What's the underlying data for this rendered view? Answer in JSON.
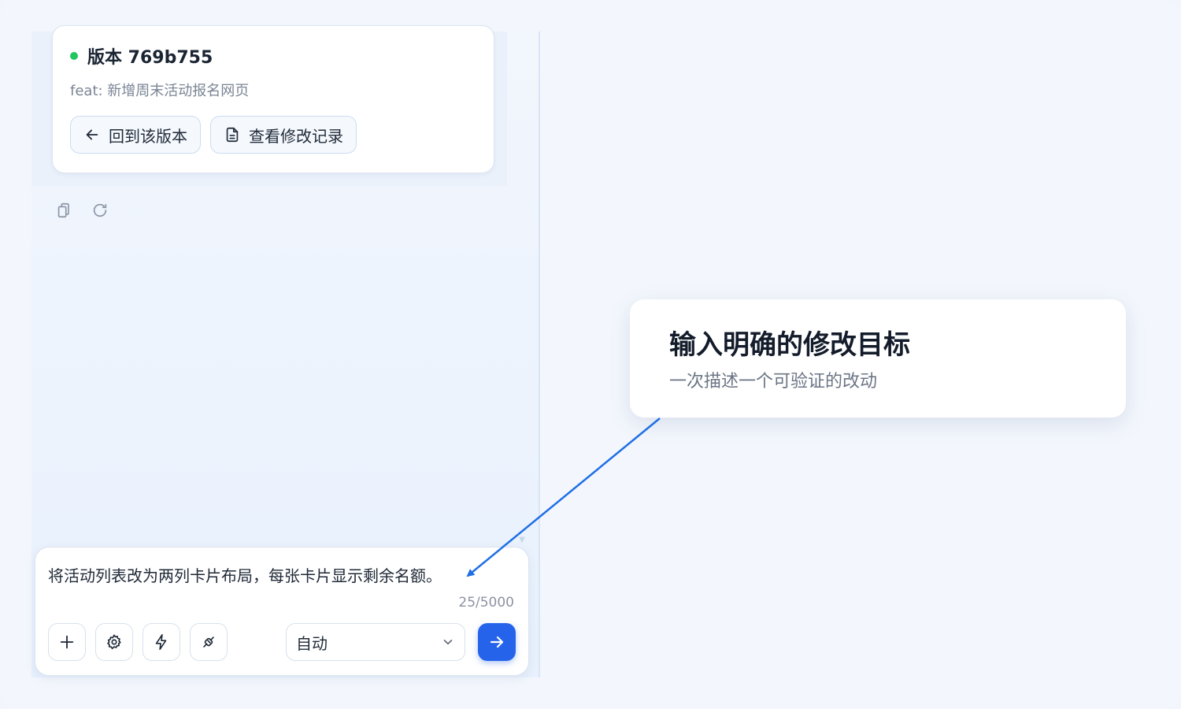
{
  "version_card": {
    "title": "版本 769b755",
    "description": "feat: 新增周末活动报名网页",
    "status_color": "#22c55e",
    "restore_label": "回到该版本",
    "history_label": "查看修改记录"
  },
  "message_tools": {
    "copy_icon": "copy-icon",
    "retry_icon": "refresh-icon"
  },
  "composer": {
    "text": "将活动列表改为两列卡片布局，每张卡片显示剩余名额。",
    "counter": "25/5000",
    "mode": "自动",
    "tools": [
      "plus-icon",
      "gear-icon",
      "lightning-icon",
      "plugin-icon"
    ],
    "send_color": "#2563eb"
  },
  "callout": {
    "title": "输入明确的修改目标",
    "subtitle": "一次描述一个可验证的改动",
    "arrow_color": "#1f6fe5"
  }
}
